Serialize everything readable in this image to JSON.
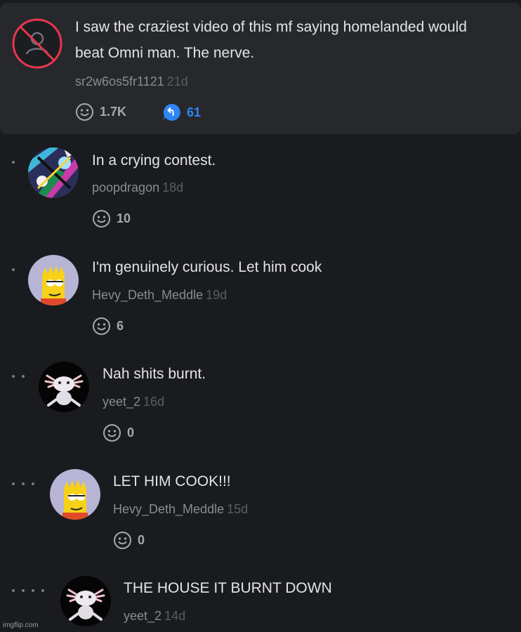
{
  "post": {
    "text_line1": "I saw the craziest video of this mf saying homelanded would",
    "text_line2": "beat Omni man. The nerve.",
    "username": "sr2w6os5fr1121",
    "age": "21d",
    "reactions": "1.7K",
    "replies": "61",
    "avatar_icon": "blocked-user-icon"
  },
  "comments": [
    {
      "text": "In a crying contest.",
      "username": "poopdragon",
      "age": "18d",
      "reactions": "10",
      "depth": 1,
      "avatar": "graffiti-avatar"
    },
    {
      "text": "I'm genuinely curious. Let him cook",
      "username": "Hevy_Deth_Meddle",
      "age": "19d",
      "reactions": "6",
      "depth": 1,
      "avatar": "bart-avatar"
    },
    {
      "text": "Nah shits burnt.",
      "username": "yeet_2",
      "age": "16d",
      "reactions": "0",
      "depth": 2,
      "avatar": "axolotl-avatar"
    },
    {
      "text": "LET HIM COOK!!!",
      "username": "Hevy_Deth_Meddle",
      "age": "15d",
      "reactions": "0",
      "depth": 3,
      "avatar": "bart-avatar"
    },
    {
      "text": "THE HOUSE IT BURNT DOWN",
      "username": "yeet_2",
      "age": "14d",
      "reactions": "",
      "depth": 4,
      "avatar": "axolotl-avatar"
    }
  ],
  "watermark": "imgflip.com",
  "colors": {
    "background": "#1a1b1f",
    "card": "#26282c",
    "reply_accent": "#2e86f5",
    "blocked_red": "#e8364f"
  }
}
